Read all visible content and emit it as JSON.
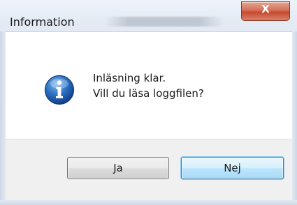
{
  "window": {
    "title": "Information",
    "close_glyph": "X"
  },
  "dialog": {
    "icon": "info-icon",
    "message_line1": "Inläsning klar.",
    "message_line2": "Vill du läsa loggfilen?"
  },
  "buttons": {
    "yes_label": "Ja",
    "no_label": "Nej"
  },
  "colors": {
    "content_bg": "#ffffff",
    "footer_bg": "#f0f0f0",
    "close_button": "#c74a2f",
    "default_button_border": "#3c7fb1",
    "icon_blue": "#1f5fb0"
  }
}
